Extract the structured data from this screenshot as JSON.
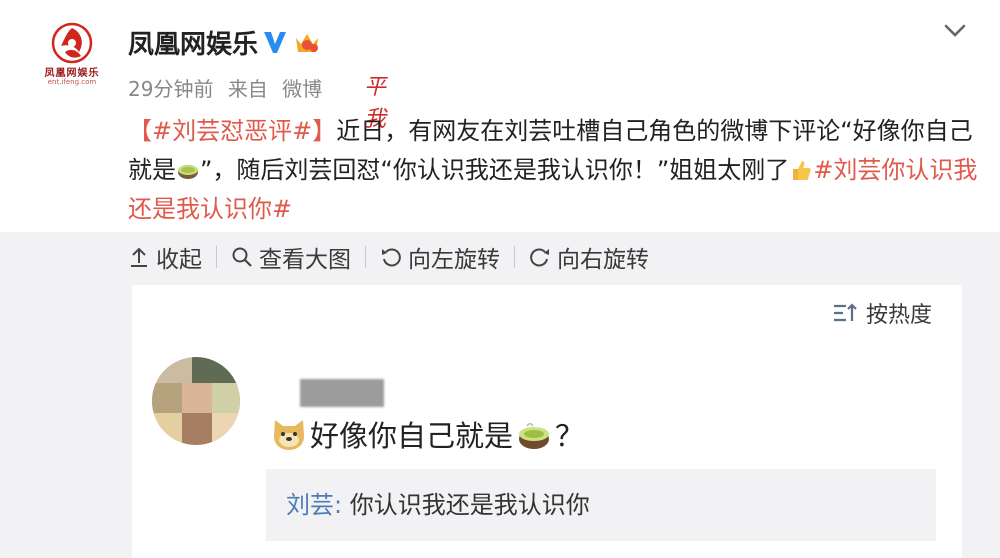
{
  "post": {
    "logo_name": "凤凰网娱乐",
    "author": "凤凰网娱乐",
    "time": "29分钟前",
    "source_prefix": "来自",
    "source_device": "微博",
    "scribble": "平我",
    "text": {
      "tag1": "【#刘芸怼恶评#】",
      "body1": "近日，有网友在刘芸吐槽自己角色的微博下评论“好像你自己就是",
      "body2": "”，随后刘芸回怼“你认识我还是我认识你！”姐姐太刚了",
      "tag2": "#刘芸你认识我还是我认识你#"
    },
    "icons": {
      "verified": "verified-v-icon",
      "vip": "vip-crown-icon",
      "menu": "chevron-down-icon"
    }
  },
  "toolbar": {
    "collapse": "收起",
    "view_large": "查看大图",
    "rotate_left": "向左旋转",
    "rotate_right": "向右旋转"
  },
  "comments": {
    "sort_label": "按热度",
    "comment": {
      "text": "好像你自己就是",
      "suffix": "？"
    },
    "reply": {
      "name": "刘芸:",
      "text": "你认识我还是我认识你"
    }
  },
  "colors": {
    "hashtag": "#e05a4c",
    "reply_name": "#4e7bb8",
    "verified": "#2b8cf0",
    "gray_bg": "#f2f2f5"
  }
}
